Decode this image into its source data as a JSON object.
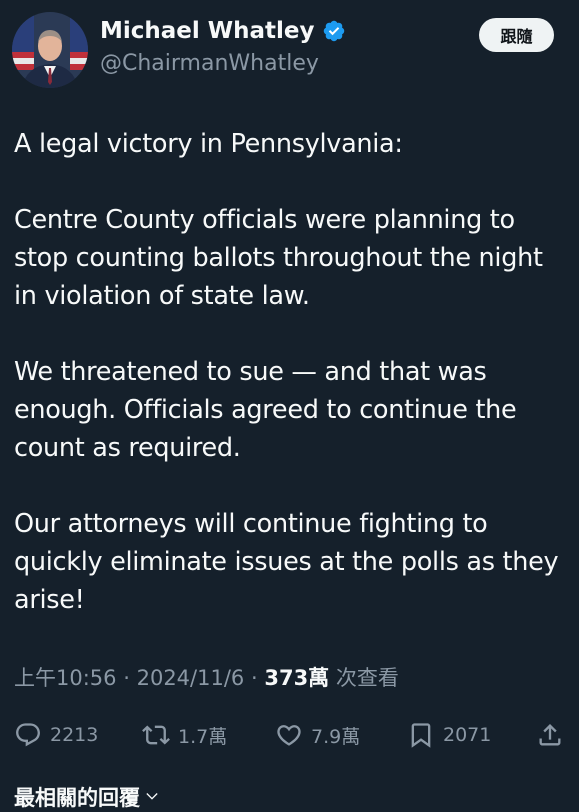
{
  "author": {
    "display_name": "Michael Whatley",
    "handle": "@ChairmanWhatley",
    "verified_icon": "verified-badge-icon"
  },
  "follow_label": "跟隨",
  "tweet": {
    "text": "A legal victory in Pennsylvania:\n\nCentre County officials were planning to stop counting ballots throughout the night in violation of state law.\n\nWe threatened to sue — and that was enough. Officials agreed to continue the count as required.\n\nOur attorneys will continue fighting to quickly eliminate issues at the polls as they arise!"
  },
  "meta": {
    "time": "上午10:56",
    "separator": "·",
    "date": "2024/11/6",
    "views_count": "373萬",
    "views_label": "次查看"
  },
  "actions": {
    "replies": "2213",
    "retweets": "1.7萬",
    "likes": "7.9萬",
    "bookmarks": "2071"
  },
  "replies_sort_label": "最相關的回覆",
  "colors": {
    "background": "#15202b",
    "text": "#f7f9f9",
    "secondary": "#8b98a5",
    "verified": "#1d9bf0"
  }
}
